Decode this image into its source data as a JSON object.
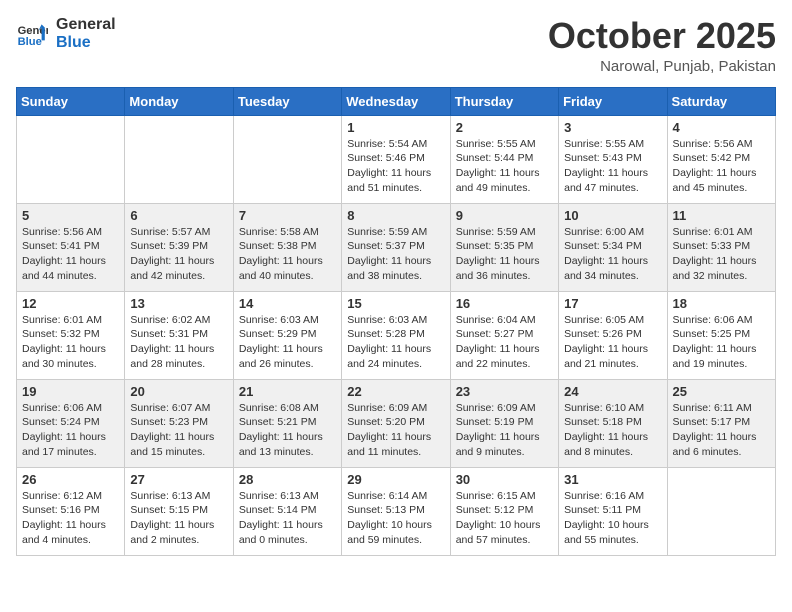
{
  "header": {
    "logo_line1": "General",
    "logo_line2": "Blue",
    "month_year": "October 2025",
    "location": "Narowal, Punjab, Pakistan"
  },
  "days_of_week": [
    "Sunday",
    "Monday",
    "Tuesday",
    "Wednesday",
    "Thursday",
    "Friday",
    "Saturday"
  ],
  "weeks": [
    [
      {
        "day": "",
        "info": ""
      },
      {
        "day": "",
        "info": ""
      },
      {
        "day": "",
        "info": ""
      },
      {
        "day": "1",
        "info": "Sunrise: 5:54 AM\nSunset: 5:46 PM\nDaylight: 11 hours\nand 51 minutes."
      },
      {
        "day": "2",
        "info": "Sunrise: 5:55 AM\nSunset: 5:44 PM\nDaylight: 11 hours\nand 49 minutes."
      },
      {
        "day": "3",
        "info": "Sunrise: 5:55 AM\nSunset: 5:43 PM\nDaylight: 11 hours\nand 47 minutes."
      },
      {
        "day": "4",
        "info": "Sunrise: 5:56 AM\nSunset: 5:42 PM\nDaylight: 11 hours\nand 45 minutes."
      }
    ],
    [
      {
        "day": "5",
        "info": "Sunrise: 5:56 AM\nSunset: 5:41 PM\nDaylight: 11 hours\nand 44 minutes."
      },
      {
        "day": "6",
        "info": "Sunrise: 5:57 AM\nSunset: 5:39 PM\nDaylight: 11 hours\nand 42 minutes."
      },
      {
        "day": "7",
        "info": "Sunrise: 5:58 AM\nSunset: 5:38 PM\nDaylight: 11 hours\nand 40 minutes."
      },
      {
        "day": "8",
        "info": "Sunrise: 5:59 AM\nSunset: 5:37 PM\nDaylight: 11 hours\nand 38 minutes."
      },
      {
        "day": "9",
        "info": "Sunrise: 5:59 AM\nSunset: 5:35 PM\nDaylight: 11 hours\nand 36 minutes."
      },
      {
        "day": "10",
        "info": "Sunrise: 6:00 AM\nSunset: 5:34 PM\nDaylight: 11 hours\nand 34 minutes."
      },
      {
        "day": "11",
        "info": "Sunrise: 6:01 AM\nSunset: 5:33 PM\nDaylight: 11 hours\nand 32 minutes."
      }
    ],
    [
      {
        "day": "12",
        "info": "Sunrise: 6:01 AM\nSunset: 5:32 PM\nDaylight: 11 hours\nand 30 minutes."
      },
      {
        "day": "13",
        "info": "Sunrise: 6:02 AM\nSunset: 5:31 PM\nDaylight: 11 hours\nand 28 minutes."
      },
      {
        "day": "14",
        "info": "Sunrise: 6:03 AM\nSunset: 5:29 PM\nDaylight: 11 hours\nand 26 minutes."
      },
      {
        "day": "15",
        "info": "Sunrise: 6:03 AM\nSunset: 5:28 PM\nDaylight: 11 hours\nand 24 minutes."
      },
      {
        "day": "16",
        "info": "Sunrise: 6:04 AM\nSunset: 5:27 PM\nDaylight: 11 hours\nand 22 minutes."
      },
      {
        "day": "17",
        "info": "Sunrise: 6:05 AM\nSunset: 5:26 PM\nDaylight: 11 hours\nand 21 minutes."
      },
      {
        "day": "18",
        "info": "Sunrise: 6:06 AM\nSunset: 5:25 PM\nDaylight: 11 hours\nand 19 minutes."
      }
    ],
    [
      {
        "day": "19",
        "info": "Sunrise: 6:06 AM\nSunset: 5:24 PM\nDaylight: 11 hours\nand 17 minutes."
      },
      {
        "day": "20",
        "info": "Sunrise: 6:07 AM\nSunset: 5:23 PM\nDaylight: 11 hours\nand 15 minutes."
      },
      {
        "day": "21",
        "info": "Sunrise: 6:08 AM\nSunset: 5:21 PM\nDaylight: 11 hours\nand 13 minutes."
      },
      {
        "day": "22",
        "info": "Sunrise: 6:09 AM\nSunset: 5:20 PM\nDaylight: 11 hours\nand 11 minutes."
      },
      {
        "day": "23",
        "info": "Sunrise: 6:09 AM\nSunset: 5:19 PM\nDaylight: 11 hours\nand 9 minutes."
      },
      {
        "day": "24",
        "info": "Sunrise: 6:10 AM\nSunset: 5:18 PM\nDaylight: 11 hours\nand 8 minutes."
      },
      {
        "day": "25",
        "info": "Sunrise: 6:11 AM\nSunset: 5:17 PM\nDaylight: 11 hours\nand 6 minutes."
      }
    ],
    [
      {
        "day": "26",
        "info": "Sunrise: 6:12 AM\nSunset: 5:16 PM\nDaylight: 11 hours\nand 4 minutes."
      },
      {
        "day": "27",
        "info": "Sunrise: 6:13 AM\nSunset: 5:15 PM\nDaylight: 11 hours\nand 2 minutes."
      },
      {
        "day": "28",
        "info": "Sunrise: 6:13 AM\nSunset: 5:14 PM\nDaylight: 11 hours\nand 0 minutes."
      },
      {
        "day": "29",
        "info": "Sunrise: 6:14 AM\nSunset: 5:13 PM\nDaylight: 10 hours\nand 59 minutes."
      },
      {
        "day": "30",
        "info": "Sunrise: 6:15 AM\nSunset: 5:12 PM\nDaylight: 10 hours\nand 57 minutes."
      },
      {
        "day": "31",
        "info": "Sunrise: 6:16 AM\nSunset: 5:11 PM\nDaylight: 10 hours\nand 55 minutes."
      },
      {
        "day": "",
        "info": ""
      }
    ]
  ],
  "shaded_weeks": [
    1,
    3
  ],
  "empty_cells": {
    "week0": [
      0,
      1,
      2
    ],
    "week4": [
      6
    ]
  }
}
